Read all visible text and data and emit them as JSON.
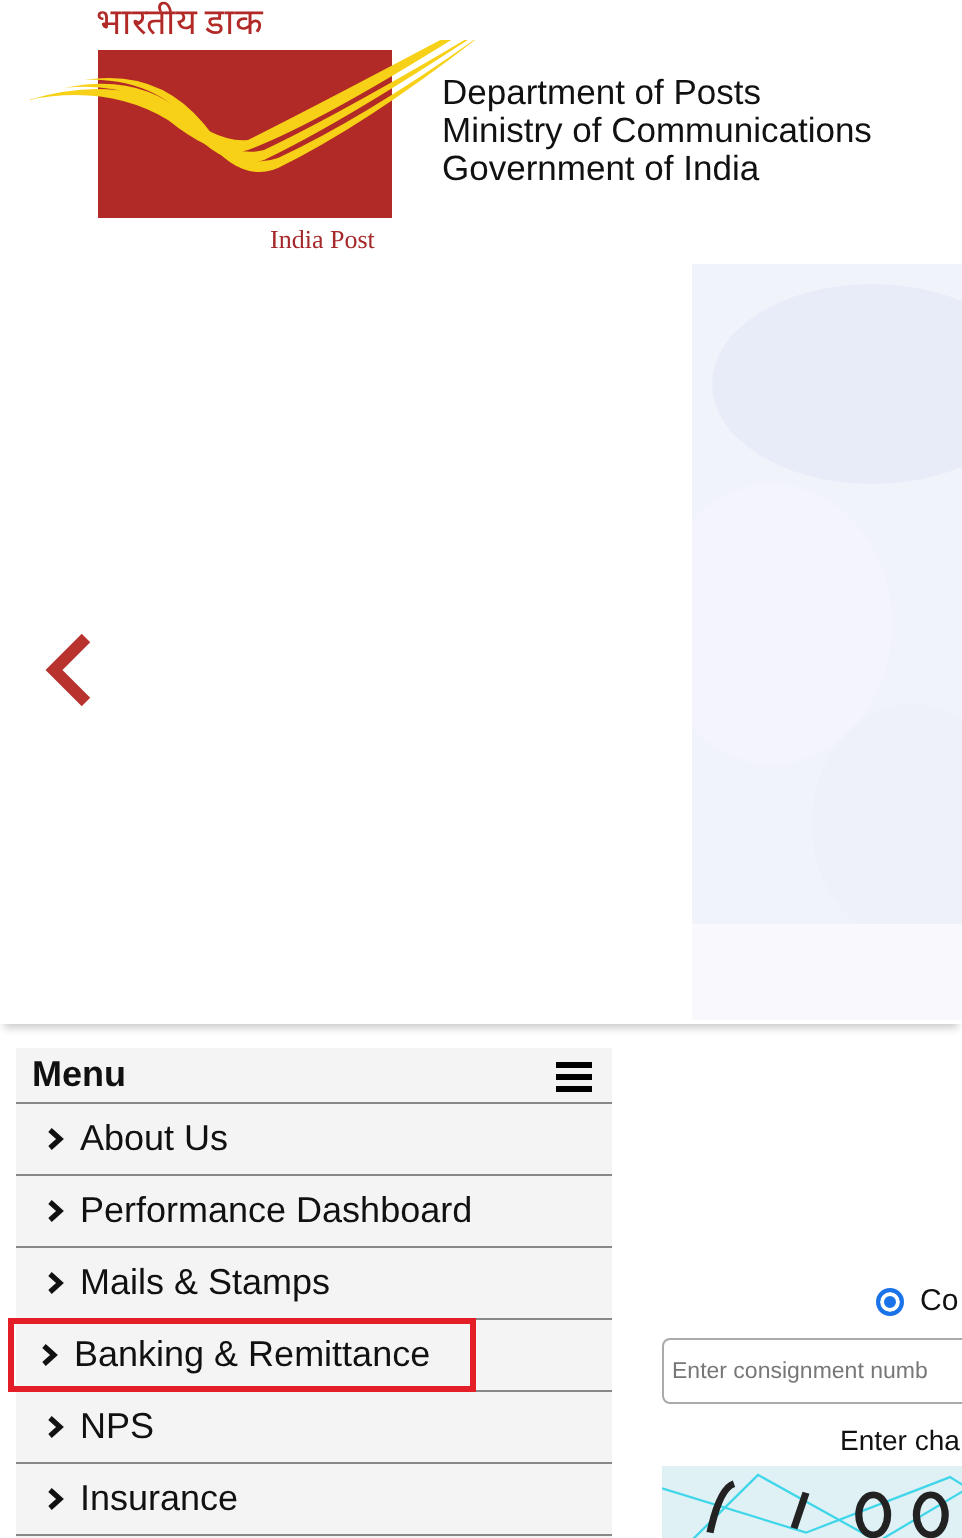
{
  "header": {
    "logo_hindi": "भारतीय डाक",
    "logo_english": "India Post",
    "lines": [
      "Department of Posts",
      "Ministry of Communications",
      "Government of India"
    ]
  },
  "menu": {
    "title": "Menu",
    "items": [
      {
        "label": "About Us",
        "highlighted": false
      },
      {
        "label": "Performance Dashboard",
        "highlighted": false
      },
      {
        "label": "Mails & Stamps",
        "highlighted": false
      },
      {
        "label": "Banking & Remittance",
        "highlighted": true
      },
      {
        "label": "NPS",
        "highlighted": false
      },
      {
        "label": "Insurance",
        "highlighted": false
      }
    ]
  },
  "tracking": {
    "option": {
      "label": "Co",
      "selected": true
    },
    "input": {
      "placeholder": "Enter consignment numb"
    },
    "captcha_label": "Enter cha"
  }
}
